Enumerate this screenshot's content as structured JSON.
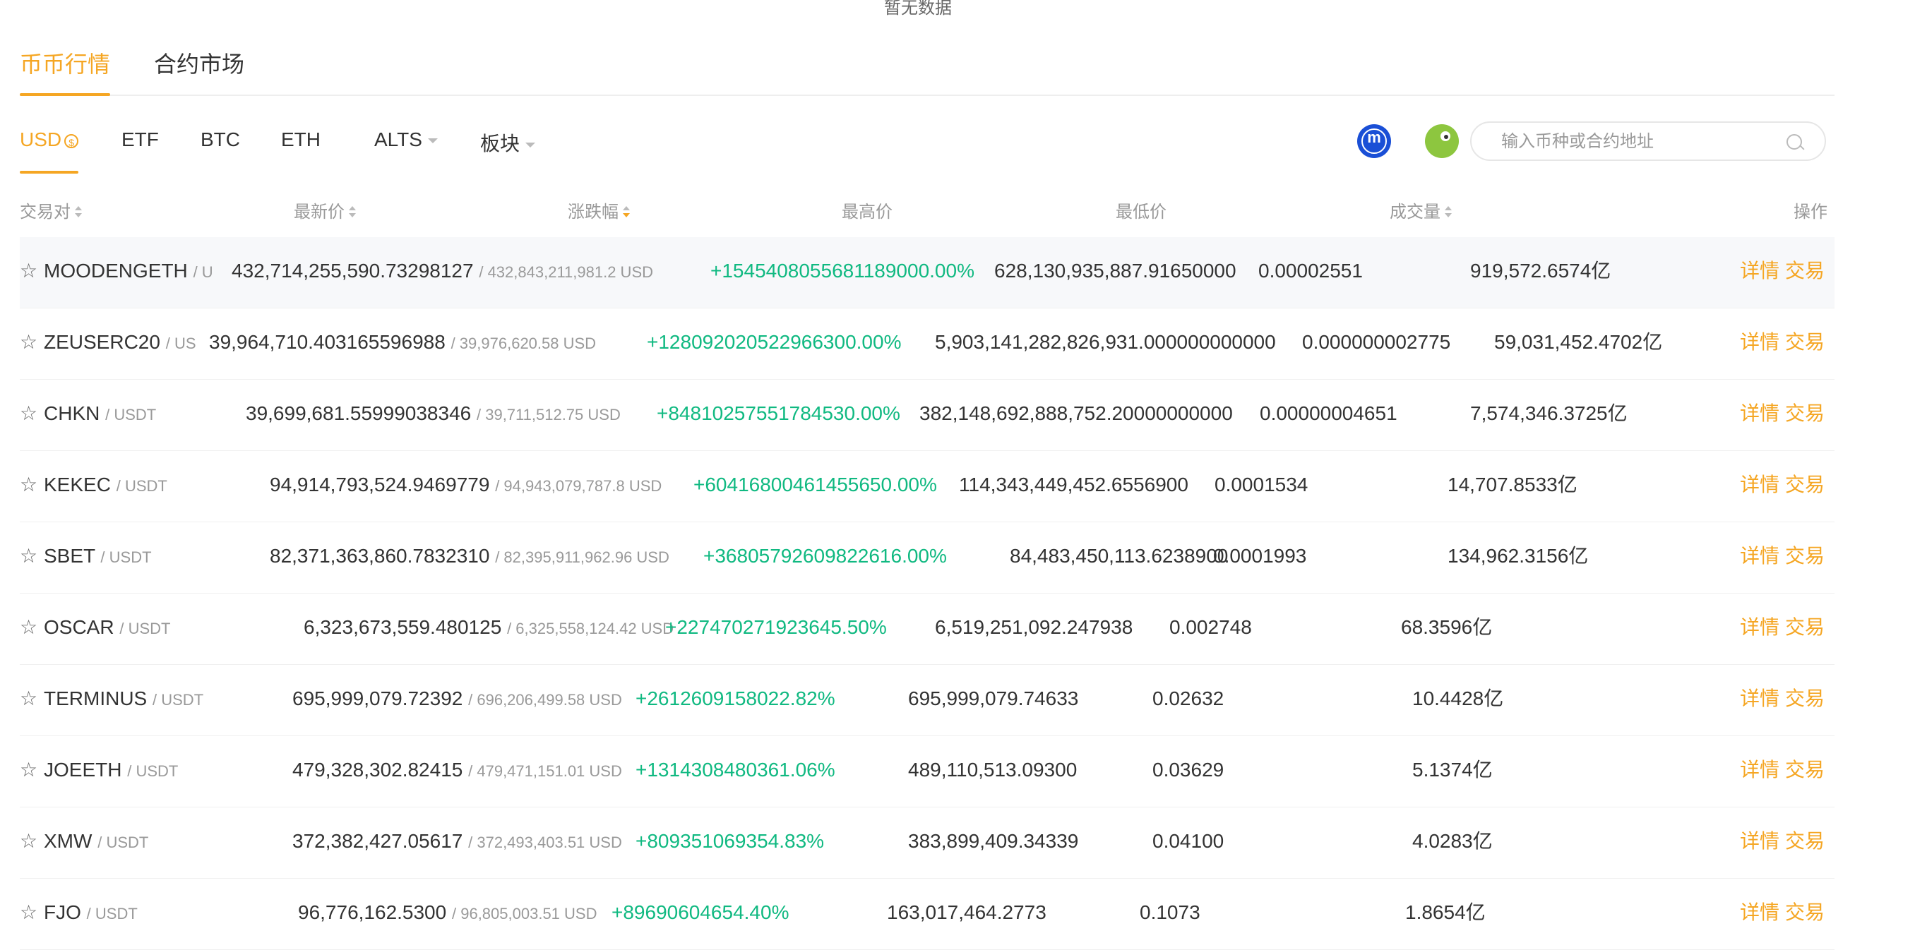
{
  "top_notice": "暂无数据",
  "main_tabs": [
    {
      "label": "币币行情",
      "active": true
    },
    {
      "label": "合约市场",
      "active": false
    }
  ],
  "sub_tabs": [
    {
      "label": "USD",
      "active": true
    },
    {
      "label": "ETF"
    },
    {
      "label": "BTC"
    },
    {
      "label": "ETH"
    },
    {
      "label": "ALTS"
    },
    {
      "label": "板块"
    }
  ],
  "search": {
    "placeholder": "输入币种或合约地址"
  },
  "columns": {
    "pair": "交易对",
    "last": "最新价",
    "change": "涨跌幅",
    "high": "最高价",
    "low": "最低价",
    "volume": "成交量",
    "ops": "操作"
  },
  "actions": {
    "detail": "详情",
    "trade": "交易"
  },
  "colors": {
    "accent": "#f5a623",
    "up": "#10b981"
  },
  "rows": [
    {
      "symbol": "MOODENGETH",
      "quote": "/ U",
      "last": "432,714,255,590.73298127",
      "usd": "/ 432,843,211,981.2 USD",
      "change": "+1545408055681189000.00%",
      "high": "628,130,935,887.91650000",
      "low": "0.00002551",
      "volume": "919,572.6574亿"
    },
    {
      "symbol": "ZEUSERC20",
      "quote": "/ US",
      "last": "39,964,710.403165596988",
      "usd": "/ 39,976,620.58 USD",
      "change": "+128092020522966300.00%",
      "high": "5,903,141,282,826,931.000000000000",
      "low": "0.000000002775",
      "volume": "59,031,452.4702亿"
    },
    {
      "symbol": "CHKN",
      "quote": "/ USDT",
      "last": "39,699,681.55999038346",
      "usd": "/ 39,711,512.75 USD",
      "change": "+8481025755178453​0.00%",
      "high": "382,148,692,888,752.20000000000",
      "low": "0.00000004651",
      "volume": "7,574,346.3725亿"
    },
    {
      "symbol": "KEKEC",
      "quote": "/ USDT",
      "last": "94,914,793,524.9469779",
      "usd": "/ 94,943,079,787.8 USD",
      "change": "+60416800461455650.00%",
      "high": "114,343,449,452.6556900",
      "low": "0.0001534",
      "volume": "14,707.8533亿"
    },
    {
      "symbol": "SBET",
      "quote": "/ USDT",
      "last": "82,371,363,860.7832310",
      "usd": "/ 82,395,911,962.96 USD",
      "change": "+36805792609822616.00%",
      "high": "84,483,450,113.6238900",
      "low": "0.0001993",
      "volume": "134,962.3156亿"
    },
    {
      "symbol": "OSCAR",
      "quote": "/ USDT",
      "last": "6,323,673,559.480125",
      "usd": "/ 6,325,558,124.42 USD",
      "change": "+227470271923645.50%",
      "high": "6,519,251,092.247938",
      "low": "0.002748",
      "volume": "68.3596亿"
    },
    {
      "symbol": "TERMINUS",
      "quote": "/ USDT",
      "last": "695,999,079.72392",
      "usd": "/ 696,206,499.58 USD",
      "change": "+2612609158022.82%",
      "high": "695,999,079.74633",
      "low": "0.02632",
      "volume": "10.4428亿"
    },
    {
      "symbol": "JOEETH",
      "quote": "/ USDT",
      "last": "479,328,302.82415",
      "usd": "/ 479,471,151.01 USD",
      "change": "+1314308480361.06%",
      "high": "489,110,513.09300",
      "low": "0.03629",
      "volume": "5.1374亿"
    },
    {
      "symbol": "XMW",
      "quote": "/ USDT",
      "last": "372,382,427.05617",
      "usd": "/ 372,493,403.51 USD",
      "change": "+809351069354.83%",
      "high": "383,899,409.34339",
      "low": "0.04100",
      "volume": "4.0283亿"
    },
    {
      "symbol": "FJO",
      "quote": "/ USDT",
      "last": "96,776,162.5300",
      "usd": "/ 96,805,003.51 USD",
      "change": "+89690604654.40%",
      "high": "163,017,464.2773",
      "low": "0.1073",
      "volume": "1.8654亿"
    }
  ]
}
